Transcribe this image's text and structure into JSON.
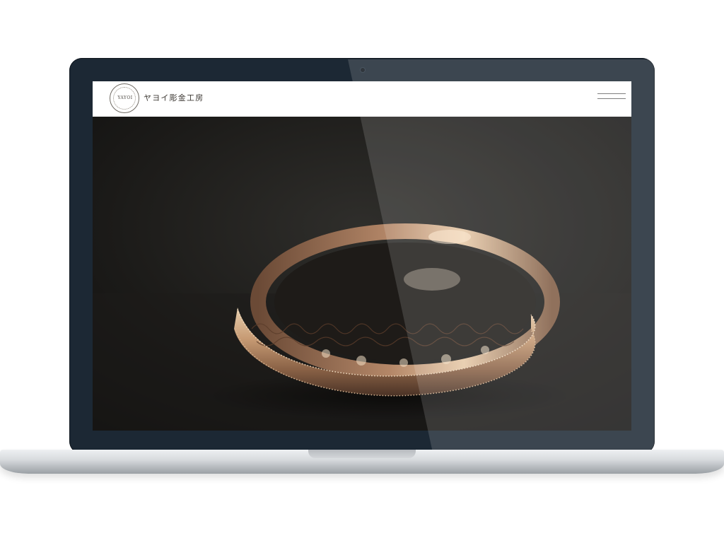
{
  "site": {
    "logo_text": "YAYOI",
    "brand_name": "ヤヨイ彫金工房",
    "menu_icon": "hamburger-menu-icon"
  },
  "hero": {
    "image": "engraved-gold-ring-photo"
  },
  "colors": {
    "lid": "#1c2834",
    "header_bg": "#ffffff",
    "hero_bg": "#1a1a1a",
    "ring_gold": "#c9a27c"
  }
}
